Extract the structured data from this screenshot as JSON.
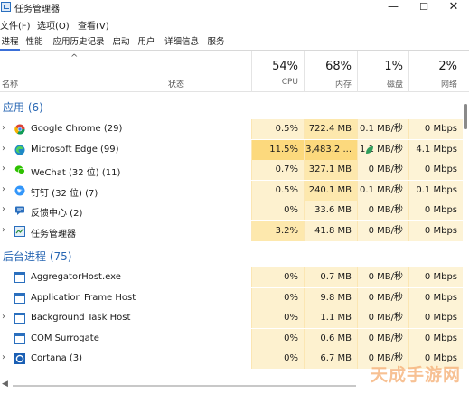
{
  "window": {
    "title": "任务管理器"
  },
  "menu": [
    "文件(F)",
    "选项(O)",
    "查看(V)"
  ],
  "tabs": [
    "进程",
    "性能",
    "应用历史记录",
    "启动",
    "用户",
    "详细信息",
    "服务"
  ],
  "columns": {
    "name": "名称",
    "status": "状态",
    "cpu": {
      "percent": "54%",
      "label": "CPU"
    },
    "memory": {
      "percent": "68%",
      "label": "内存"
    },
    "disk": {
      "percent": "1%",
      "label": "磁盘"
    },
    "network": {
      "percent": "2%",
      "label": "网络"
    }
  },
  "groups": {
    "apps": "应用 (6)",
    "background": "后台进程 (75)"
  },
  "apps": [
    {
      "name": "Google Chrome (29)",
      "icon": "chrome-icon",
      "cpu": "0.5%",
      "mem": "722.4 MB",
      "disk": "0.1 MB/秒",
      "net": "0 Mbps"
    },
    {
      "name": "Microsoft Edge (99)",
      "icon": "edge-icon",
      "cpu": "11.5%",
      "mem": "3,483.2 ...",
      "disk": "1.1 MB/秒",
      "net": "4.1 Mbps",
      "leaf": true
    },
    {
      "name": "WeChat (32 位) (11)",
      "icon": "wechat-icon",
      "cpu": "0.7%",
      "mem": "327.1 MB",
      "disk": "0 MB/秒",
      "net": "0 Mbps"
    },
    {
      "name": "钉钉 (32 位) (7)",
      "icon": "dingtalk-icon",
      "cpu": "0.5%",
      "mem": "240.1 MB",
      "disk": "0.1 MB/秒",
      "net": "0.1 Mbps"
    },
    {
      "name": "反馈中心 (2)",
      "icon": "feedback-icon",
      "cpu": "0%",
      "mem": "33.6 MB",
      "disk": "0 MB/秒",
      "net": "0 Mbps"
    },
    {
      "name": "任务管理器",
      "icon": "task-manager-icon",
      "cpu": "3.2%",
      "mem": "41.8 MB",
      "disk": "0 MB/秒",
      "net": "0 Mbps"
    }
  ],
  "background": [
    {
      "name": "AggregatorHost.exe",
      "icon": "window-icon",
      "cpu": "0%",
      "mem": "0.7 MB",
      "disk": "0 MB/秒",
      "net": "0 Mbps"
    },
    {
      "name": "Application Frame Host",
      "icon": "window-icon",
      "cpu": "0%",
      "mem": "9.8 MB",
      "disk": "0 MB/秒",
      "net": "0 Mbps"
    },
    {
      "name": "Background Task Host",
      "icon": "window-icon",
      "cpu": "0%",
      "mem": "1.1 MB",
      "disk": "0 MB/秒",
      "net": "0 Mbps",
      "expandable": true
    },
    {
      "name": "COM Surrogate",
      "icon": "window-icon",
      "cpu": "0%",
      "mem": "0.6 MB",
      "disk": "0 MB/秒",
      "net": "0 Mbps"
    },
    {
      "name": "Cortana (3)",
      "icon": "cortana-icon",
      "cpu": "0%",
      "mem": "6.7 MB",
      "disk": "0 MB/秒",
      "net": "0 Mbps",
      "expandable": true
    }
  ],
  "watermark": "天成手游网",
  "colors": {
    "heat_light": "#fdf3d6",
    "heat_mid": "#fde8ad",
    "heat_strong": "#fcd97d",
    "group_blue": "#2766b3"
  }
}
